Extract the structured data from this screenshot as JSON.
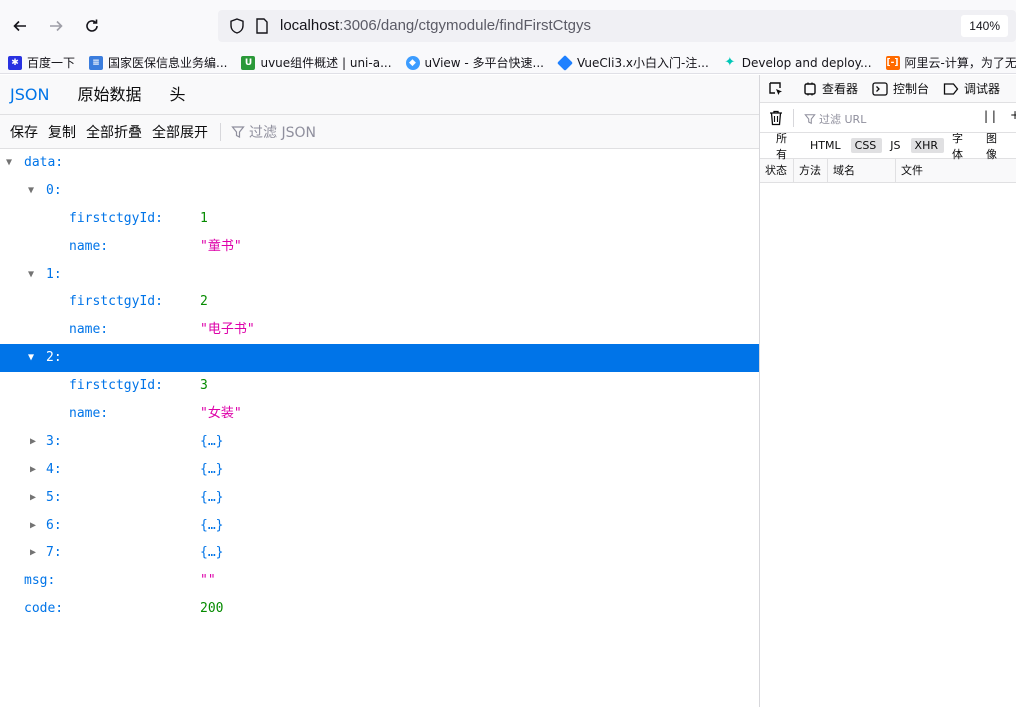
{
  "browser": {
    "url_host": "localhost",
    "url_path": ":3006/dang/ctgymodule/findFirstCtgys",
    "zoom": "140%"
  },
  "bookmarks": [
    {
      "label": "百度一下",
      "icon": "paw-icon",
      "color": "#2932e1"
    },
    {
      "label": "国家医保信息业务编...",
      "icon": "blue-doc-icon",
      "color": "#3b7ddd"
    },
    {
      "label": "uvue组件概述 | uni-a...",
      "icon": "u-icon",
      "color": "#2b9939"
    },
    {
      "label": "uView - 多平台快速...",
      "icon": "uview-icon",
      "color": "#3c9cff"
    },
    {
      "label": "VueCli3.x小白入门-注...",
      "icon": "diamond-icon",
      "color": "#1e80ff"
    },
    {
      "label": "Develop and deploy...",
      "icon": "sparkle-icon",
      "color": "#00c7b7"
    },
    {
      "label": "阿里云-计算，为了无",
      "icon": "aliyun-icon",
      "color": "#ff6a00"
    }
  ],
  "viewer": {
    "tabs": [
      "JSON",
      "原始数据",
      "头"
    ],
    "actions": {
      "save": "保存",
      "copy": "复制",
      "collapse_all": "全部折叠",
      "expand_all": "全部展开",
      "filter_placeholder": "过滤 JSON"
    }
  },
  "tree": {
    "data_key": "data:",
    "items": [
      {
        "key": "0:",
        "firstctgyId": "1",
        "name": "\"童书\""
      },
      {
        "key": "1:",
        "firstctgyId": "2",
        "name": "\"电子书\""
      },
      {
        "key": "2:",
        "firstctgyId": "3",
        "name": "\"女装\""
      }
    ],
    "field_labels": {
      "id": "firstctgyId:",
      "name": "name:"
    },
    "collapsed": [
      {
        "key": "3:",
        "value": "{…}"
      },
      {
        "key": "4:",
        "value": "{…}"
      },
      {
        "key": "5:",
        "value": "{…}"
      },
      {
        "key": "6:",
        "value": "{…}"
      },
      {
        "key": "7:",
        "value": "{…}"
      }
    ],
    "msg_key": "msg:",
    "msg_value": "\"\"",
    "code_key": "code:",
    "code_value": "200"
  },
  "devtools": {
    "tabs": {
      "inspector": "查看器",
      "console": "控制台",
      "debugger": "调试器"
    },
    "filter_url": "过滤 URL",
    "pause": "| |",
    "plus": "+",
    "types": [
      "所有",
      "HTML",
      "CSS",
      "JS",
      "XHR",
      "字体",
      "图像"
    ],
    "columns": [
      "状态",
      "方法",
      "域名",
      "文件"
    ]
  },
  "colors": {
    "accent": "#0074e8",
    "number": "#058b00",
    "string": "#dd00a9"
  }
}
